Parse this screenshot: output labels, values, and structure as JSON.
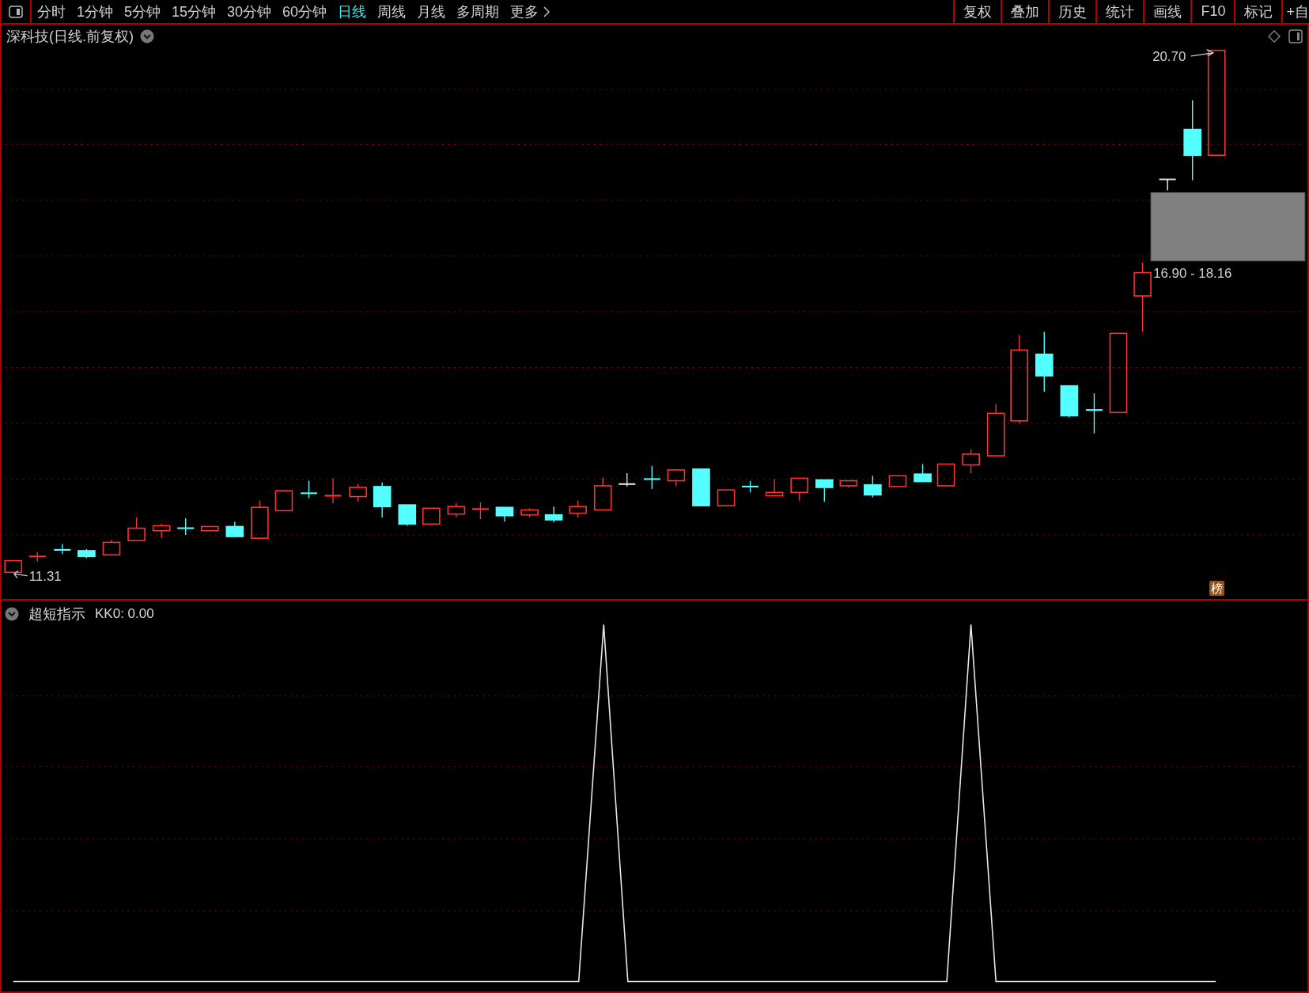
{
  "toolbar": {
    "periods": [
      {
        "label": "分时",
        "selected": false
      },
      {
        "label": "1分钟",
        "selected": false
      },
      {
        "label": "5分钟",
        "selected": false
      },
      {
        "label": "15分钟",
        "selected": false
      },
      {
        "label": "30分钟",
        "selected": false
      },
      {
        "label": "60分钟",
        "selected": false
      },
      {
        "label": "日线",
        "selected": true
      },
      {
        "label": "周线",
        "selected": false
      },
      {
        "label": "月线",
        "selected": false
      },
      {
        "label": "多周期",
        "selected": false
      }
    ],
    "more": "更多",
    "tools": [
      "复权",
      "叠加",
      "历史",
      "统计",
      "画线",
      "F10",
      "标记",
      "+自"
    ]
  },
  "chart": {
    "title": "深科技(日线.前复权)",
    "high_label": "20.70",
    "range_label": "16.90 - 18.16",
    "low_label": "11.31",
    "badge": "榜"
  },
  "indicator": {
    "name": "超短指示",
    "reading": "KK0: 0.00"
  }
}
